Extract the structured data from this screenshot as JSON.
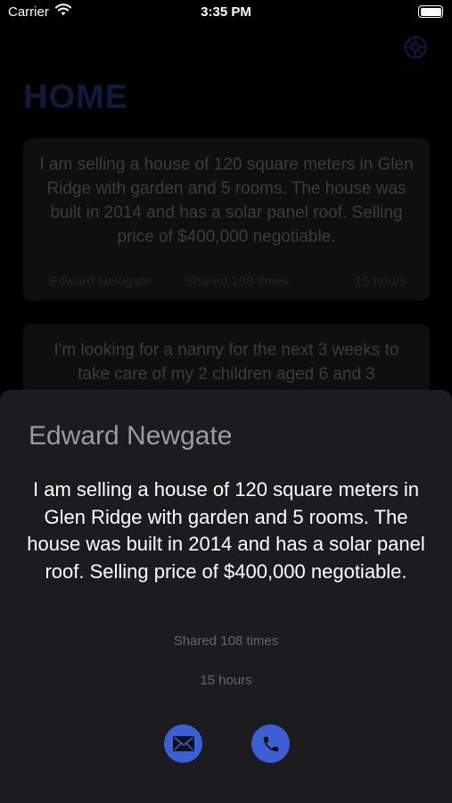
{
  "status_bar": {
    "carrier": "Carrier",
    "time": "3:35 PM"
  },
  "home": {
    "title": "HOME",
    "posts": [
      {
        "text": "I am selling a house of 120 square meters in Glen Ridge with garden and 5 rooms. The house was built in 2014 and has a solar panel roof. Selling price of $400,000 negotiable.",
        "author": "Edward Newgate",
        "shares": "Shared 108 times",
        "time": "15 hours"
      },
      {
        "text": "I'm looking for a nanny for the next 3 weeks to take care of my 2 children aged 6 and 3"
      }
    ]
  },
  "sheet": {
    "author": "Edward Newgate",
    "body": "I am selling a house of 120 square meters in Glen Ridge with garden and 5 rooms. The house was built in 2014 and has a solar panel roof. Selling price of $400,000 negotiable.",
    "shares": "Shared 108 times",
    "time": "15 hours",
    "actions": [
      {
        "icon": "envelope-icon"
      },
      {
        "icon": "phone-icon"
      }
    ]
  },
  "colors": {
    "accent": "#3d5fd6",
    "sheet_background": "#1c1c1e",
    "title": "#0d1c3e"
  }
}
